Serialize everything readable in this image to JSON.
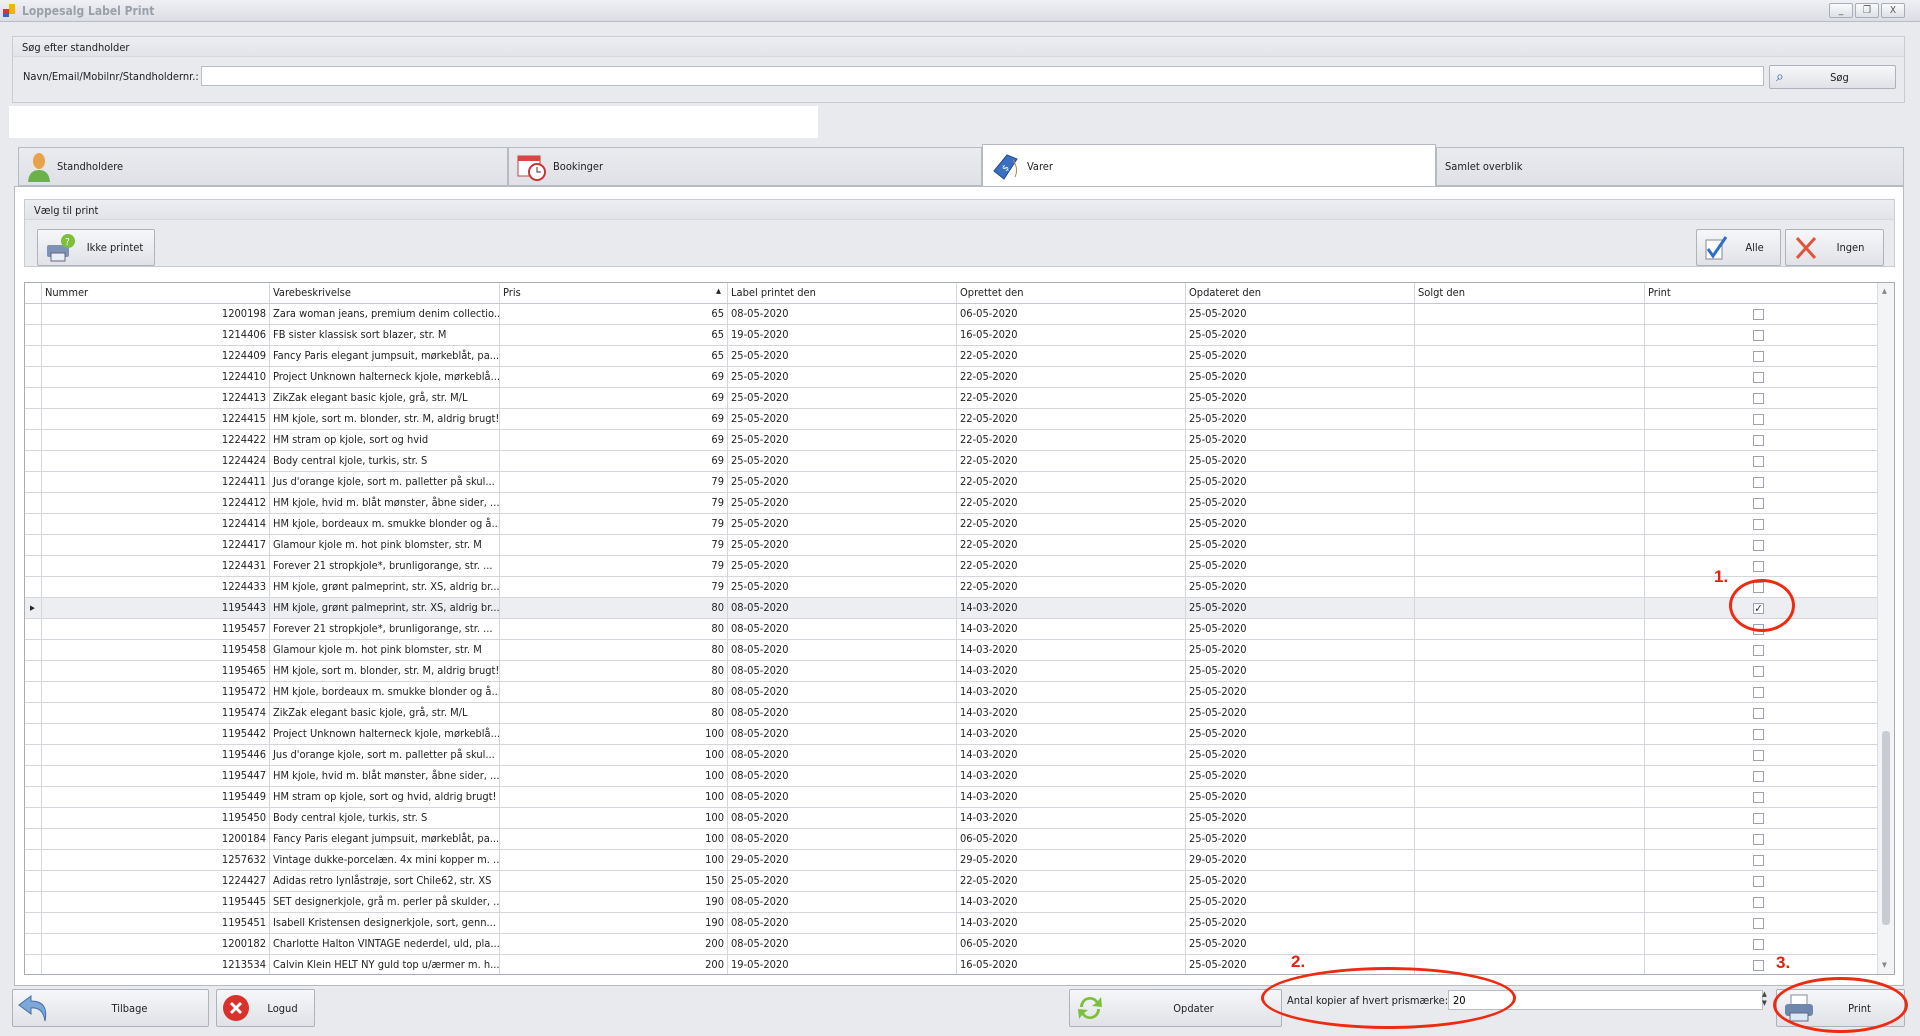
{
  "window": {
    "title": "Loppesalg Label Print",
    "controls": [
      "_",
      "❐",
      "X"
    ]
  },
  "search": {
    "group_title": "Søg efter standholder",
    "label": "Navn/Email/Mobilnr/Standholdernr.:",
    "value": "",
    "button": "Søg"
  },
  "tabs": [
    {
      "label": "Standholdere",
      "icon": "person-icon"
    },
    {
      "label": "Bookinger",
      "icon": "calendar-clock-icon"
    },
    {
      "label": "Varer",
      "icon": "price-tag-icon",
      "active": true
    },
    {
      "label": "Samlet overblik"
    }
  ],
  "print_group": {
    "title": "Vælg til print",
    "not_printed": "Ikke printet",
    "all": "Alle",
    "none": "Ingen"
  },
  "grid": {
    "columns": [
      "Nummer",
      "Varebeskrivelse",
      "Pris",
      "Label printet den",
      "Oprettet den",
      "Opdateret den",
      "Solgt den",
      "Print"
    ],
    "sorted_column": "Pris",
    "sort_direction": "ascending",
    "selected_row": 14,
    "rows": [
      [
        "1200198",
        "Zara woman jeans, premium denim collectio...",
        "65",
        "08-05-2020",
        "06-05-2020",
        "25-05-2020",
        "",
        false
      ],
      [
        "1214406",
        "FB sister klassisk sort blazer, str. M",
        "65",
        "19-05-2020",
        "16-05-2020",
        "25-05-2020",
        "",
        false
      ],
      [
        "1224409",
        "Fancy Paris elegant jumpsuit, mørkeblåt, pa...",
        "65",
        "25-05-2020",
        "22-05-2020",
        "25-05-2020",
        "",
        false
      ],
      [
        "1224410",
        "Project Unknown halterneck kjole, mørkeblå...",
        "69",
        "25-05-2020",
        "22-05-2020",
        "25-05-2020",
        "",
        false
      ],
      [
        "1224413",
        "ZikZak elegant basic kjole, grå, str. M/L",
        "69",
        "25-05-2020",
        "22-05-2020",
        "25-05-2020",
        "",
        false
      ],
      [
        "1224415",
        "HM kjole, sort m. blonder, str. M, aldrig brugt!",
        "69",
        "25-05-2020",
        "22-05-2020",
        "25-05-2020",
        "",
        false
      ],
      [
        "1224422",
        "HM stram op kjole, sort og hvid",
        "69",
        "25-05-2020",
        "22-05-2020",
        "25-05-2020",
        "",
        false
      ],
      [
        "1224424",
        "Body central kjole, turkis, str. S",
        "69",
        "25-05-2020",
        "22-05-2020",
        "25-05-2020",
        "",
        false
      ],
      [
        "1224411",
        "Jus d'orange kjole, sort m. palletter på skul...",
        "79",
        "25-05-2020",
        "22-05-2020",
        "25-05-2020",
        "",
        false
      ],
      [
        "1224412",
        "HM kjole, hvid m. blåt mønster, åbne sider, ...",
        "79",
        "25-05-2020",
        "22-05-2020",
        "25-05-2020",
        "",
        false
      ],
      [
        "1224414",
        "HM kjole, bordeaux m. smukke blonder og å...",
        "79",
        "25-05-2020",
        "22-05-2020",
        "25-05-2020",
        "",
        false
      ],
      [
        "1224417",
        "Glamour kjole m. hot pink blomster, str. M",
        "79",
        "25-05-2020",
        "22-05-2020",
        "25-05-2020",
        "",
        false
      ],
      [
        "1224431",
        "Forever 21 stropkjole*, brunligorange, str. ...",
        "79",
        "25-05-2020",
        "22-05-2020",
        "25-05-2020",
        "",
        false
      ],
      [
        "1224433",
        "HM kjole, grønt palmeprint, str. XS, aldrig br...",
        "79",
        "25-05-2020",
        "22-05-2020",
        "25-05-2020",
        "",
        false
      ],
      [
        "1195443",
        "HM kjole, grønt palmeprint, str. XS, aldrig br...",
        "80",
        "08-05-2020",
        "14-03-2020",
        "25-05-2020",
        "",
        true
      ],
      [
        "1195457",
        "Forever 21 stropkjole*, brunligorange, str. ...",
        "80",
        "08-05-2020",
        "14-03-2020",
        "25-05-2020",
        "",
        false
      ],
      [
        "1195458",
        "Glamour kjole m. hot pink blomster, str. M",
        "80",
        "08-05-2020",
        "14-03-2020",
        "25-05-2020",
        "",
        false
      ],
      [
        "1195465",
        "HM kjole, sort m. blonder, str. M, aldrig brugt!",
        "80",
        "08-05-2020",
        "14-03-2020",
        "25-05-2020",
        "",
        false
      ],
      [
        "1195472",
        "HM kjole, bordeaux m. smukke blonder og å...",
        "80",
        "08-05-2020",
        "14-03-2020",
        "25-05-2020",
        "",
        false
      ],
      [
        "1195474",
        "ZikZak elegant basic kjole, grå, str. M/L",
        "80",
        "08-05-2020",
        "14-03-2020",
        "25-05-2020",
        "",
        false
      ],
      [
        "1195442",
        "Project Unknown halterneck kjole, mørkeblå...",
        "100",
        "08-05-2020",
        "14-03-2020",
        "25-05-2020",
        "",
        false
      ],
      [
        "1195446",
        "Jus d'orange kjole, sort m. palletter på skul...",
        "100",
        "08-05-2020",
        "14-03-2020",
        "25-05-2020",
        "",
        false
      ],
      [
        "1195447",
        "HM kjole, hvid m. blåt mønster, åbne sider, ...",
        "100",
        "08-05-2020",
        "14-03-2020",
        "25-05-2020",
        "",
        false
      ],
      [
        "1195449",
        "HM stram op kjole, sort og hvid, aldrig brugt!",
        "100",
        "08-05-2020",
        "14-03-2020",
        "25-05-2020",
        "",
        false
      ],
      [
        "1195450",
        "Body central kjole, turkis, str. S",
        "100",
        "08-05-2020",
        "14-03-2020",
        "25-05-2020",
        "",
        false
      ],
      [
        "1200184",
        "Fancy Paris elegant jumpsuit, mørkeblåt, pa...",
        "100",
        "08-05-2020",
        "06-05-2020",
        "25-05-2020",
        "",
        false
      ],
      [
        "1257632",
        "Vintage dukke-porcelæn. 4x mini kopper m. ...",
        "100",
        "29-05-2020",
        "29-05-2020",
        "29-05-2020",
        "",
        false
      ],
      [
        "1224427",
        "Adidas retro lynlåstrøje, sort Chile62, str. XS",
        "150",
        "25-05-2020",
        "22-05-2020",
        "25-05-2020",
        "",
        false
      ],
      [
        "1195445",
        "SET designerkjole, grå m. perler på skulder, ...",
        "190",
        "08-05-2020",
        "14-03-2020",
        "25-05-2020",
        "",
        false
      ],
      [
        "1195451",
        "Isabell Kristensen designerkjole, sort, genn...",
        "190",
        "08-05-2020",
        "14-03-2020",
        "25-05-2020",
        "",
        false
      ],
      [
        "1200182",
        "Charlotte Halton VINTAGE nederdel, uld, pla...",
        "200",
        "08-05-2020",
        "06-05-2020",
        "25-05-2020",
        "",
        false
      ],
      [
        "1213534",
        "Calvin Klein HELT NY guld top u/ærmer m. h...",
        "200",
        "19-05-2020",
        "16-05-2020",
        "25-05-2020",
        "",
        false
      ]
    ]
  },
  "footer": {
    "back": "Tilbage",
    "logout": "Logud",
    "refresh": "Opdater",
    "copies_label": "Antal kopier af hvert prismærke:",
    "copies_value": "20",
    "print": "Print"
  },
  "annotations": [
    "1.",
    "2.",
    "3."
  ],
  "colors": {
    "annotation": "#ef2a10",
    "accent": "#2a5db0"
  }
}
